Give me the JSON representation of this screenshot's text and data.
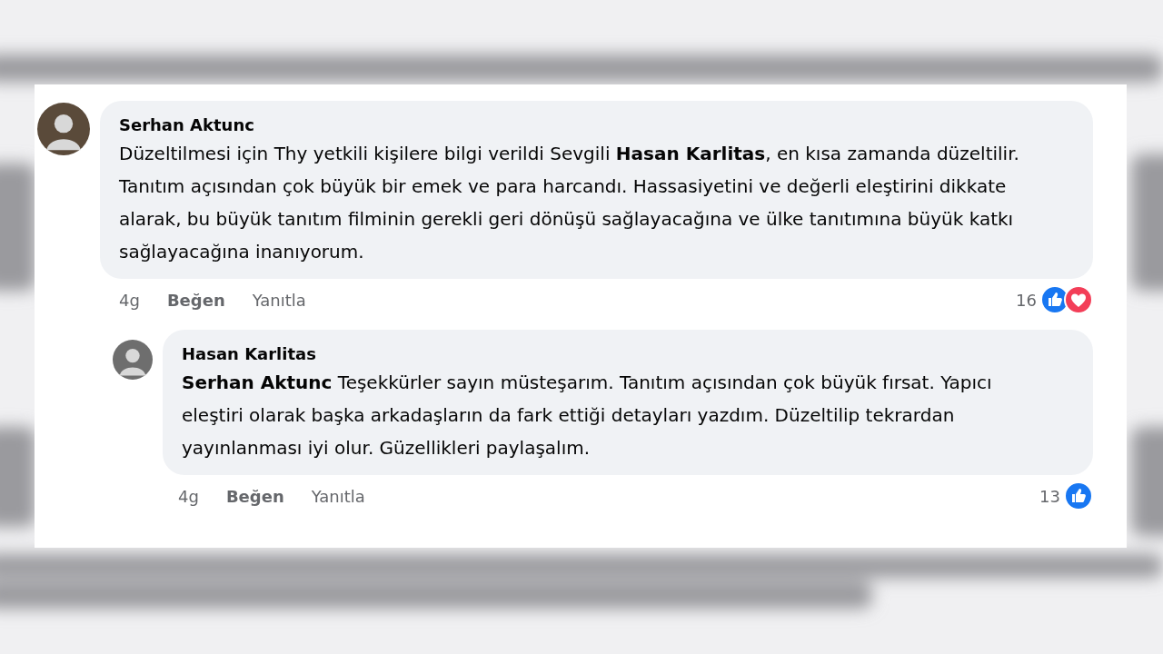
{
  "comments": [
    {
      "author": "Serhan Aktunc",
      "paragraphs": [
        "Düzeltilmesi için Thy yetkili kişilere bilgi verildi Sevgili **Hasan Karlitas**, en kısa zamanda düzeltilir.",
        "Tanıtım açısından çok büyük bir emek ve para harcandı. Hassasiyetini ve değerli eleştirini dikkate alarak, bu büyük tanıtım filminin gerekli geri dönüşü sağlayacağına ve ülke tanıtımına büyük katkı sağlayacağına inanıyorum."
      ],
      "time": "4g",
      "like": "Beğen",
      "reply": "Yanıtla",
      "reaction_count": "16",
      "reactions": [
        {
          "kind": "like"
        },
        {
          "kind": "love"
        }
      ],
      "is_reply": false
    },
    {
      "author": "Hasan Karlitas",
      "paragraphs": [
        "**Serhan Aktunc** Teşekkürler sayın müsteşarım. Tanıtım açısından çok büyük fırsat. Yapıcı eleştiri olarak başka arkadaşların da fark ettiği detayları yazdım. Düzeltilip tekrardan yayınlanması iyi olur. Güzellikleri paylaşalım."
      ],
      "time": "4g",
      "like": "Beğen",
      "reply": "Yanıtla",
      "reaction_count": "13",
      "reactions": [
        {
          "kind": "like"
        }
      ],
      "is_reply": true
    }
  ]
}
